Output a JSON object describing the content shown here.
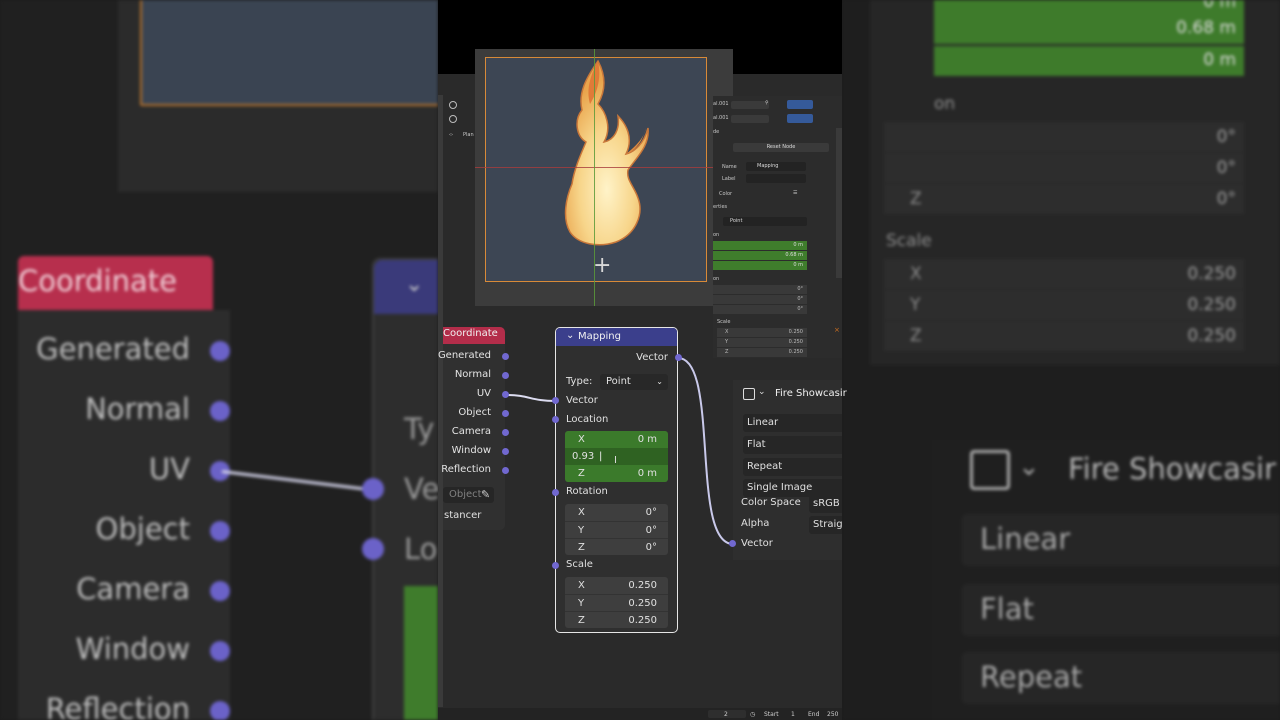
{
  "background_left": {
    "coordinate_label": "Coordinate",
    "sockets": [
      "Generated",
      "Normal",
      "UV",
      "Object",
      "Camera",
      "Window",
      "Reflection"
    ],
    "side_labels": [
      "Ty",
      "Ve",
      "Lo"
    ]
  },
  "background_right": {
    "values_top": [
      "0 m",
      "0.68 m",
      "0 m"
    ],
    "rotation_label": "on",
    "rotation": [
      {
        "axis": "",
        "value": "0°"
      },
      {
        "axis": "",
        "value": "0°"
      },
      {
        "axis": "Z",
        "value": "0°"
      }
    ],
    "scale_label": "Scale",
    "scale": [
      {
        "axis": "X",
        "value": "0.250"
      },
      {
        "axis": "Y",
        "value": "0.250"
      },
      {
        "axis": "Z",
        "value": "0.250"
      }
    ],
    "image_name": "Fire Showcasir",
    "options": [
      "Linear",
      "Flat",
      "Repeat"
    ]
  },
  "header": {
    "object_name": "Plan"
  },
  "properties_panel": {
    "title_suffix": "al.001",
    "title_suffix2": "al.001",
    "node_label": "de",
    "reset_button": "Reset Node",
    "name_label": "Name",
    "name_value": "Mapping",
    "label_label": "Label",
    "color_label": "Color",
    "properties_label": "erties",
    "type_value": "Point",
    "location_label": "on",
    "location": [
      "0 m",
      "0.68 m",
      "0 m"
    ],
    "rotation_label": "on",
    "rotation": [
      {
        "axis": "X",
        "value": "0°"
      },
      {
        "axis": "Y",
        "value": "0°"
      },
      {
        "axis": "Z",
        "value": "0°"
      }
    ],
    "scale_label": "Scale",
    "scale": [
      {
        "axis": "X",
        "value": "0.250"
      },
      {
        "axis": "Y",
        "value": "0.250"
      },
      {
        "axis": "Z",
        "value": "0.250"
      }
    ]
  },
  "texture_coordinate_node": {
    "title": "Coordinate",
    "sockets": [
      "Generated",
      "Normal",
      "UV",
      "Object",
      "Camera",
      "Window",
      "Reflection"
    ],
    "object_field_placeholder": "Object",
    "instancer_label": "stancer"
  },
  "mapping_node": {
    "title": "Mapping",
    "output_vector": "Vector",
    "type_label": "Type:",
    "type_value": "Point",
    "vector_input": "Vector",
    "location_label": "Location",
    "location": [
      {
        "axis": "X",
        "value": "0 m"
      },
      {
        "axis": "",
        "value": "0.93"
      },
      {
        "axis": "Z",
        "value": "0 m"
      }
    ],
    "rotation_label": "Rotation",
    "rotation": [
      {
        "axis": "X",
        "value": "0°"
      },
      {
        "axis": "Y",
        "value": "0°"
      },
      {
        "axis": "Z",
        "value": "0°"
      }
    ],
    "scale_label": "Scale",
    "scale": [
      {
        "axis": "X",
        "value": "0.250"
      },
      {
        "axis": "Y",
        "value": "0.250"
      },
      {
        "axis": "Z",
        "value": "0.250"
      }
    ]
  },
  "image_texture_node": {
    "image_name": "Fire Showcasir",
    "interpolation": "Linear",
    "projection": "Flat",
    "extension": "Repeat",
    "source": "Single Image",
    "color_space_label": "Color Space",
    "color_space_value": "sRGB",
    "alpha_label": "Alpha",
    "alpha_value": "Straig",
    "vector_input": "Vector"
  },
  "timeline": {
    "current_frame": "2",
    "start_label": "Start",
    "start_value": "1",
    "end_label": "End",
    "end_value": "250"
  },
  "colors": {
    "texcoord_header": "#b32d4a",
    "mapping_header": "#3b3f8c",
    "socket_vector": "#7168d0",
    "field_green": "#3b7a2b",
    "selection_outline": "#d88a38"
  }
}
